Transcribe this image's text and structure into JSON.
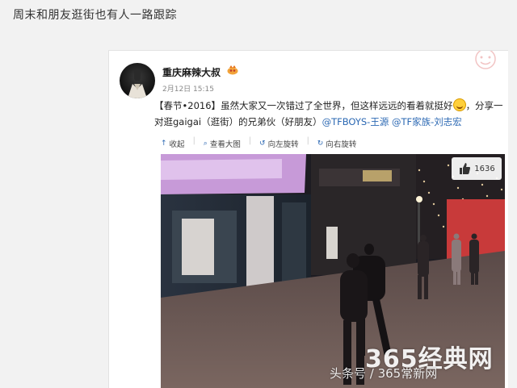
{
  "caption": "周末和朋友逛街也有人一路跟踪",
  "post": {
    "username": "重庆麻辣大叔",
    "timestamp": "2月12日 15:15",
    "hashtag": "【春节•2016】",
    "text_part1": "虽然大家又一次错过了全世界，但这样远远的看着就挺好",
    "text_part2": "，分享一对逛gaigai（逛街）的兄弟伙（好朋友）",
    "mention1": "@TFBOYS-王源",
    "mention2": "@TF家族-刘志宏"
  },
  "toolbar": {
    "collect": "收起",
    "view_large": "查看大图",
    "rotate_left": "向左旋转",
    "rotate_right": "向右旋转"
  },
  "photo": {
    "like_count": "1636"
  },
  "watermarks": {
    "main": "365经典网",
    "sub": "头条号 / 365常新网"
  },
  "icons": [
    "avatar",
    "vip-icon",
    "like-icon",
    "emoji-icon",
    "collapse-icon",
    "magnify-icon",
    "rotate-left-icon",
    "rotate-right-icon"
  ]
}
